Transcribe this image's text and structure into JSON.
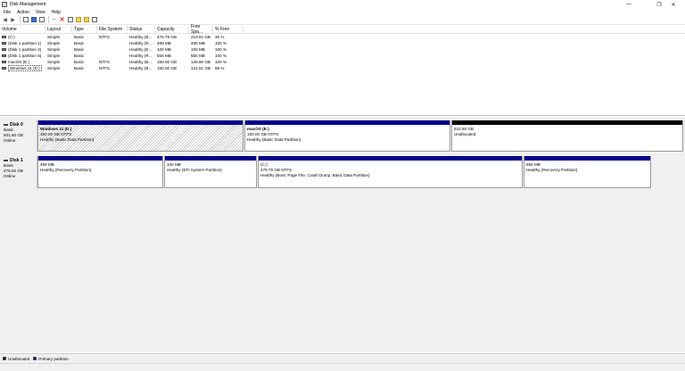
{
  "window": {
    "title": "Disk Management",
    "controls": {
      "minimize": "—",
      "maximize": "❐",
      "close": "✕"
    }
  },
  "menu": [
    "File",
    "Action",
    "View",
    "Help"
  ],
  "toolbar": {
    "icons": [
      "back-arrow-icon",
      "forward-arrow-icon",
      "show-list-icon",
      "help-icon",
      "properties-icon",
      "connect-icon",
      "delete-icon",
      "checklist-icon",
      "open-folder-icon",
      "rescan-icon",
      "view-icon"
    ]
  },
  "volumes": {
    "columns": [
      "Volume",
      "Layout",
      "Type",
      "File System",
      "Status",
      "Capacity",
      "Free Spa...",
      "% Free"
    ],
    "rows": [
      [
        "(C:)",
        "Simple",
        "Basic",
        "NTFS",
        "Healthy (B...",
        "475.79 GB",
        "219.81 GB",
        "46 %"
      ],
      [
        "(Disk 1 partition 1)",
        "Simple",
        "Basic",
        "",
        "Healthy (R...",
        "499 MB",
        "499 MB",
        "100 %"
      ],
      [
        "(Disk 1 partition 2)",
        "Simple",
        "Basic",
        "",
        "Healthy (E...",
        "100 MB",
        "100 MB",
        "100 %"
      ],
      [
        "(Disk 1 partition 5)",
        "Simple",
        "Basic",
        "",
        "Healthy (R...",
        "556 MB",
        "556 MB",
        "100 %"
      ],
      [
        "macOS (E:)",
        "Simple",
        "Basic",
        "NTFS",
        "Healthy (B...",
        "150.00 GB",
        "149.90 GB",
        "100 %"
      ],
      [
        "Windows 11 (D:)",
        "Simple",
        "Basic",
        "NTFS",
        "Healthy (B...",
        "150.00 GB",
        "131.51 GB",
        "88 %"
      ]
    ],
    "selected_row": 5
  },
  "disks": [
    {
      "name": "Disk 0",
      "type": "Basic",
      "size": "931.50 GB",
      "status": "Online",
      "partitions": [
        {
          "name": "Windows 11  (D:)",
          "detail": "150.00 GB NTFS",
          "status": "Healthy (Basic Data Partition)",
          "bar": "primary",
          "selected": true
        },
        {
          "name": "macOS  (E:)",
          "detail": "150.00 GB NTFS",
          "status": "Healthy (Basic Data Partition)",
          "bar": "primary"
        },
        {
          "name": "",
          "detail": "631.50 GB",
          "status": "Unallocated",
          "bar": "unallocated"
        }
      ]
    },
    {
      "name": "Disk 1",
      "type": "Basic",
      "size": "476.92 GB",
      "status": "Online",
      "partitions": [
        {
          "name": "",
          "detail": "499 MB",
          "status": "Healthy (Recovery Partition)",
          "bar": "primary"
        },
        {
          "name": "",
          "detail": "100 MB",
          "status": "Healthy (EFI System Partition)",
          "bar": "primary"
        },
        {
          "name": "",
          "detail": "(C:)",
          "detail2": "475.79 GB NTFS",
          "status": "Healthy (Boot, Page File, Crash Dump, Basic Data Partition)",
          "bar": "primary"
        },
        {
          "name": "",
          "detail": "556 MB",
          "status": "Healthy (Recovery Partition)",
          "bar": "primary"
        }
      ]
    }
  ],
  "legend": [
    {
      "label": "Unallocated",
      "color": "#000000"
    },
    {
      "label": "Primary partition",
      "color": "#00008b"
    }
  ]
}
